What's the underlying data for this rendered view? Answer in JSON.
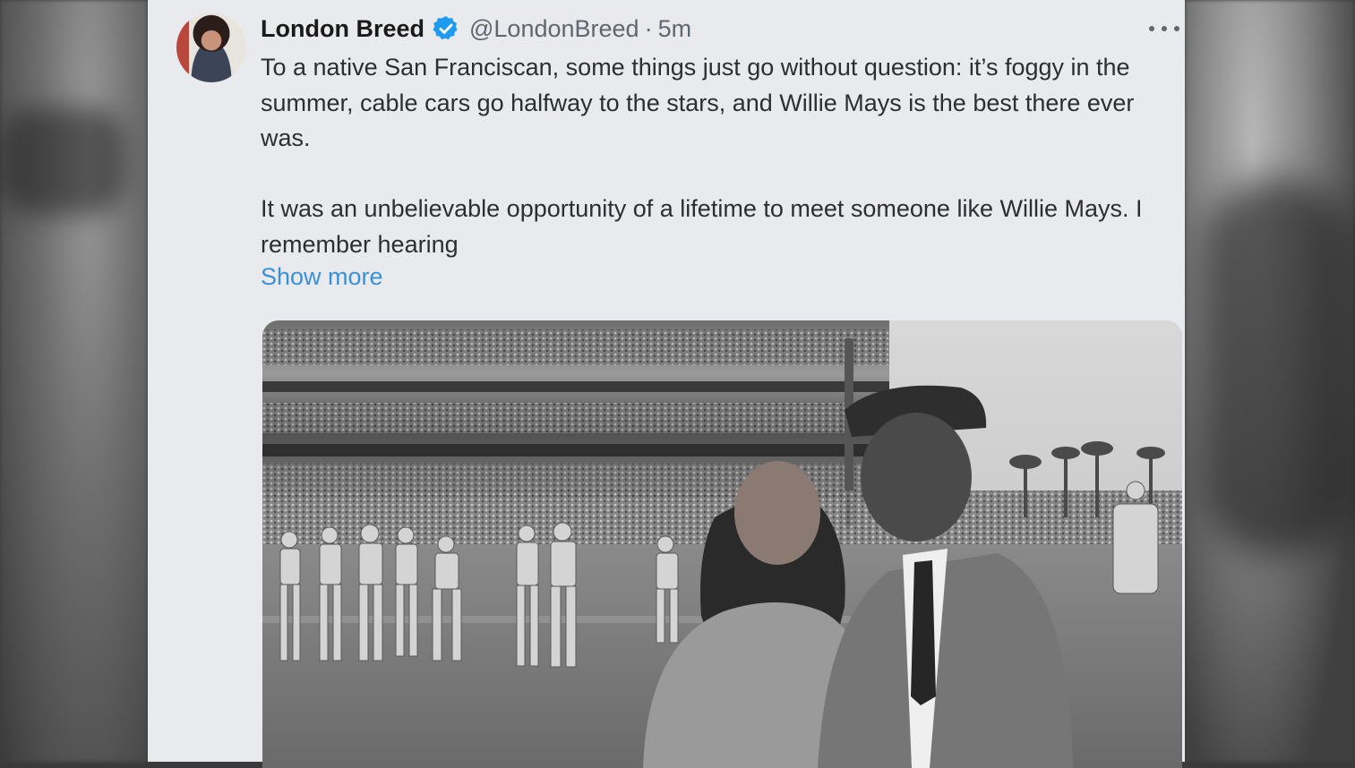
{
  "tweet": {
    "author": {
      "display_name": "London Breed",
      "handle": "@LondonBreed",
      "verified": true
    },
    "separator": "·",
    "timestamp": "5m",
    "text_paragraphs": [
      "To a native San Franciscan, some things just go without question: it’s foggy in the summer, cable cars go halfway to the stars, and Willie Mays is the best there ever was.",
      "It was an unbelievable opportunity of a lifetime to meet someone like Willie Mays. I remember hearing"
    ],
    "show_more_label": "Show more",
    "media": {
      "type": "photo"
    }
  },
  "icons": {
    "verified": "verified-badge-icon",
    "more": "more-options-icon"
  },
  "colors": {
    "card_background": "#e9eaee",
    "link_blue": "#3a92d6",
    "verified_blue": "#1d9bf0",
    "text_primary": "#1a1a1a",
    "text_secondary": "#5f6770"
  }
}
